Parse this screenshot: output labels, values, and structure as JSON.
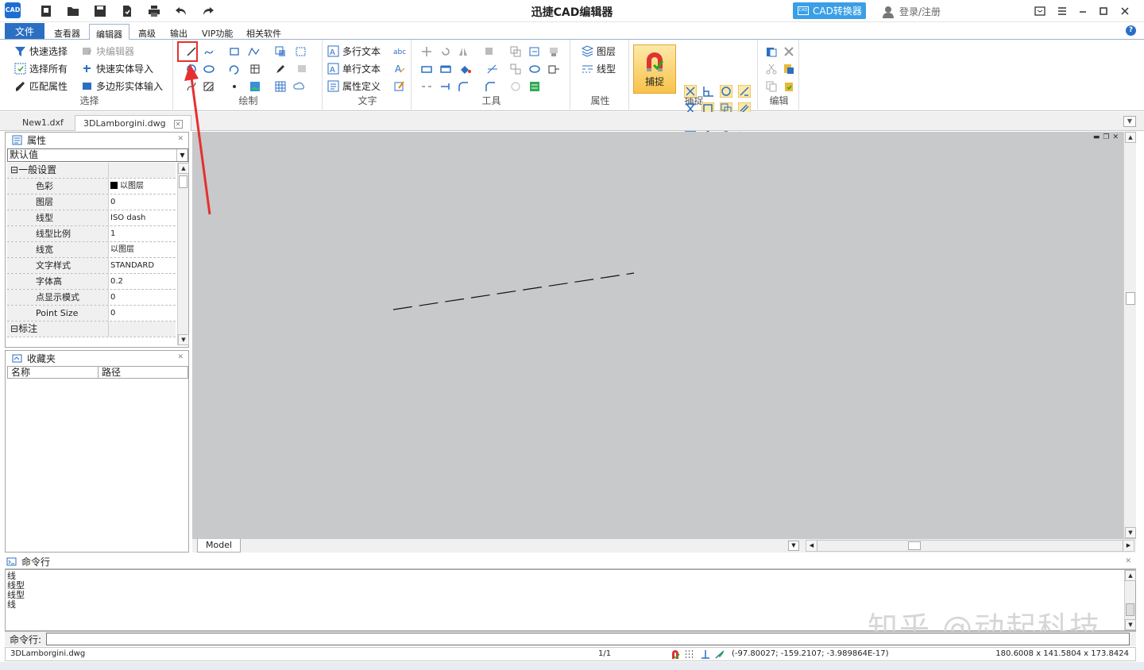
{
  "app": {
    "title": "迅捷CAD编辑器",
    "logo_text": "CAD",
    "converter_button": "CAD转换器",
    "login": "登录/注册"
  },
  "menu": {
    "tabs": [
      "文件",
      "查看器",
      "编辑器",
      "高级",
      "输出",
      "VIP功能",
      "相关软件"
    ],
    "active": "编辑器"
  },
  "ribbon": {
    "select": {
      "label": "选择",
      "quick_select": "快速选择",
      "select_all": "选择所有",
      "match_props": "匹配属性",
      "block_editor": "块编辑器",
      "quick_entity_import": "快速实体导入",
      "polygon_entity_input": "多边形实体输入"
    },
    "draw": {
      "label": "绘制"
    },
    "text": {
      "label": "文字",
      "mtext": "多行文本",
      "stext": "单行文本",
      "attdef": "属性定义"
    },
    "tools": {
      "label": "工具"
    },
    "props": {
      "label": "属性",
      "layer": "图层",
      "linetype": "线型"
    },
    "snap": {
      "label": "捕捉",
      "big_button": "捕捉"
    },
    "edit": {
      "label": "编辑"
    }
  },
  "doc_tabs": [
    "New1.dxf",
    "3DLamborgini.dwg"
  ],
  "properties_panel": {
    "title": "属性",
    "combo_value": "默认值",
    "section_general": "一般设置",
    "rows": [
      {
        "k": "色彩",
        "v": "以图层"
      },
      {
        "k": "图层",
        "v": "0"
      },
      {
        "k": "线型",
        "v": "ISO dash"
      },
      {
        "k": "线型比例",
        "v": "1"
      },
      {
        "k": "线宽",
        "v": "以图层"
      },
      {
        "k": "文字样式",
        "v": "STANDARD"
      },
      {
        "k": "字体高",
        "v": "0.2"
      },
      {
        "k": "点显示模式",
        "v": "0"
      },
      {
        "k": "Point Size",
        "v": "0"
      }
    ],
    "section_dimension": "标注"
  },
  "favorites_panel": {
    "title": "收藏夹",
    "col_name": "名称",
    "col_path": "路径"
  },
  "model_tab": "Model",
  "command": {
    "title": "命令行",
    "history": [
      "线",
      "线型",
      "线型",
      "线"
    ],
    "prompt": "命令行:"
  },
  "watermark": "知乎 @动起科技",
  "status": {
    "file": "3DLamborgini.dwg",
    "page": "1/1",
    "coords": "(-97.80027; -159.2107; -3.989864E-17)",
    "extents": "180.6008 x 141.5804 x 173.8424"
  },
  "colors": {
    "accent": "#2b6fc3",
    "canvas": "#c8c9cb",
    "highlight": "#e53030",
    "converter": "#3b9fe6"
  }
}
